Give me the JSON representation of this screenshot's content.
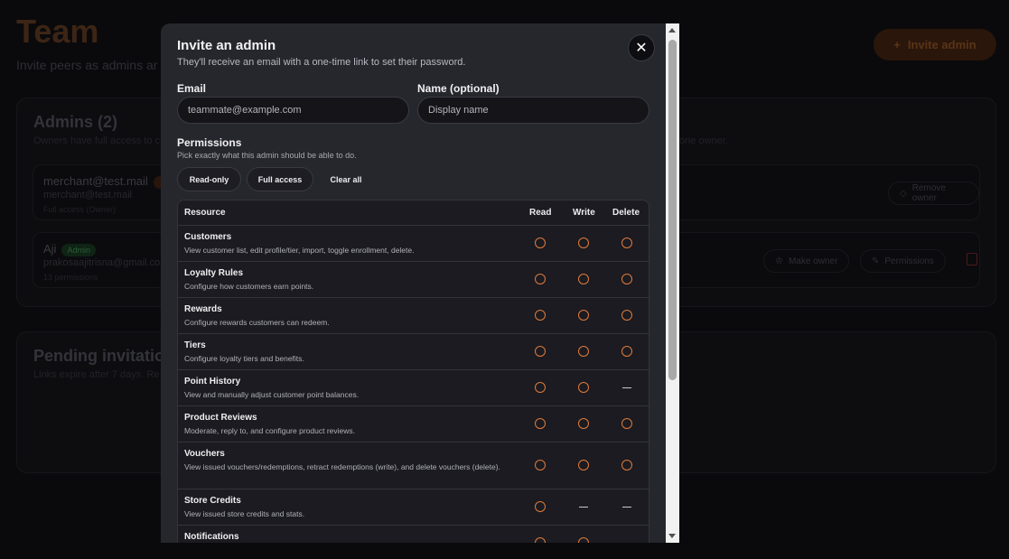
{
  "background": {
    "title": "Team",
    "subtitle": "Invite peers as admins ar",
    "invite_button": "Invite admin",
    "admins_card": {
      "title": "Admins (2)",
      "subtitle": "Owners have full access to c",
      "subtitle_right": "one owner.",
      "rows": [
        {
          "email": "merchant@test.mail",
          "secondary": "merchant@test.mail",
          "meta": "Full access (Owner)",
          "action": "Remove owner"
        },
        {
          "email": "Aji",
          "badge": "Admin",
          "secondary": "prakosaajitrisna@gmail.co",
          "meta": "13 permissions",
          "action_1": "Make owner",
          "action_2": "Permissions"
        }
      ]
    },
    "pending_card": {
      "title": "Pending invitatio",
      "subtitle": "Links expire after 7 days. Re"
    }
  },
  "modal": {
    "title": "Invite an admin",
    "subtitle": "They'll receive an email with a one-time link to set their password.",
    "close_symbol": "✕",
    "email": {
      "label": "Email",
      "placeholder": "teammate@example.com"
    },
    "name": {
      "label": "Name (optional)",
      "placeholder": "Display name"
    },
    "permissions": {
      "title": "Permissions",
      "subtitle": "Pick exactly what this admin should be able to do.",
      "presets": [
        "Read-only",
        "Full access",
        "Clear all"
      ]
    },
    "table": {
      "headers": {
        "resource": "Resource",
        "read": "Read",
        "write": "Write",
        "delete": "Delete"
      },
      "rows": [
        {
          "name": "Customers",
          "desc": "View customer list, edit profile/tier, import, toggle enrollment, delete.",
          "read": "unchecked",
          "write": "unchecked",
          "delete": "unchecked"
        },
        {
          "name": "Loyalty Rules",
          "desc": "Configure how customers earn points.",
          "read": "unchecked",
          "write": "unchecked",
          "delete": "unchecked"
        },
        {
          "name": "Rewards",
          "desc": "Configure rewards customers can redeem.",
          "read": "unchecked",
          "write": "unchecked",
          "delete": "unchecked"
        },
        {
          "name": "Tiers",
          "desc": "Configure loyalty tiers and benefits.",
          "read": "unchecked",
          "write": "unchecked",
          "delete": "unchecked"
        },
        {
          "name": "Point History",
          "desc": "View and manually adjust customer point balances.",
          "read": "unchecked",
          "write": "unchecked",
          "delete": "n/a"
        },
        {
          "name": "Product Reviews",
          "desc": "Moderate, reply to, and configure product reviews.",
          "read": "unchecked",
          "write": "unchecked",
          "delete": "unchecked"
        },
        {
          "name": "Vouchers",
          "desc": "View issued vouchers/redemptions, retract redemptions (write), and delete vouchers (delete).",
          "read": "unchecked",
          "write": "unchecked",
          "delete": "unchecked",
          "tall": true
        },
        {
          "name": "Store Credits",
          "desc": "View issued store credits and stats.",
          "read": "unchecked",
          "write": "n/a",
          "delete": "n/a"
        },
        {
          "name": "Notifications",
          "desc": "",
          "read": "unchecked",
          "write": "unchecked",
          "delete": "n/a"
        }
      ]
    }
  },
  "colors": {
    "accent": "#e07a3a",
    "modal_bg": "#26262d",
    "page_bg": "#000000"
  }
}
